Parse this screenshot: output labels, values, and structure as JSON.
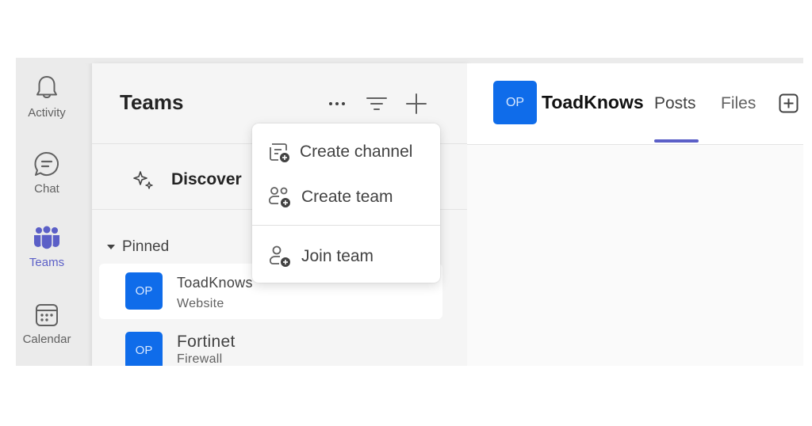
{
  "rail": {
    "items": [
      {
        "label": "Activity",
        "icon": "bell-icon"
      },
      {
        "label": "Chat",
        "icon": "chat-icon"
      },
      {
        "label": "Teams",
        "icon": "teams-icon",
        "active": true
      },
      {
        "label": "Calendar",
        "icon": "calendar-icon"
      }
    ]
  },
  "panel": {
    "title": "Teams",
    "header_icons": [
      "more-options-icon",
      "filter-icon",
      "add-icon"
    ],
    "discover_label": "Discover",
    "pinned_label": "Pinned",
    "teams": [
      {
        "initials": "OP",
        "name": "ToadKnows",
        "subtitle": "Website",
        "selected": true
      },
      {
        "initials": "OP",
        "name": "Fortinet",
        "subtitle": "Firewall",
        "selected": false
      }
    ]
  },
  "menu": {
    "items": [
      {
        "label": "Create channel",
        "icon": "create-channel-icon"
      },
      {
        "label": "Create team",
        "icon": "create-team-icon"
      },
      {
        "label": "Join team",
        "icon": "join-team-icon"
      }
    ]
  },
  "main": {
    "avatar_initials": "OP",
    "title": "ToadKnows",
    "tabs": [
      {
        "label": "Posts",
        "active": true
      },
      {
        "label": "Files",
        "active": false
      }
    ]
  },
  "colors": {
    "accent": "#5b5fc7",
    "avatar": "#0f6cea"
  }
}
